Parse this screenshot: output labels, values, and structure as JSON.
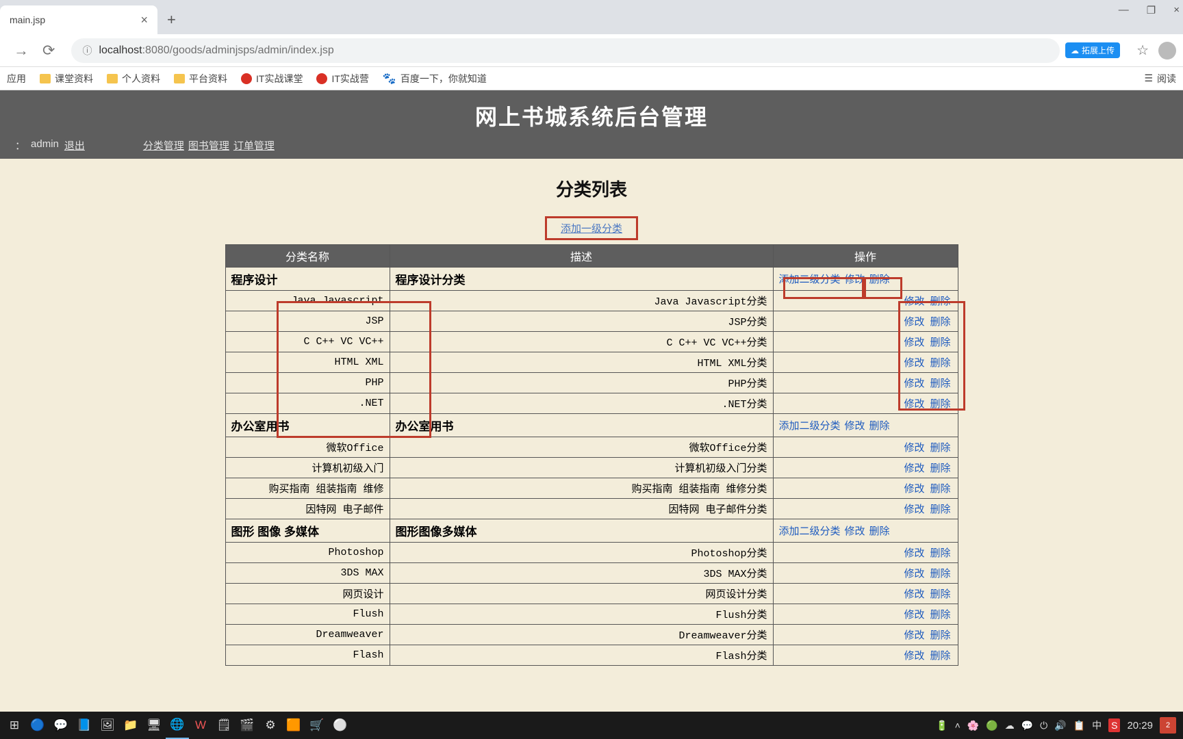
{
  "browser": {
    "tab_title": "main.jsp",
    "tab_close": "×",
    "new_tab": "+",
    "win_minimize": "—",
    "win_restore": "❐",
    "win_close": "×",
    "nav_forward": "→",
    "reload": "⟳",
    "url_icon": "ⓘ",
    "url_host": "localhost",
    "url_port_path": ":8080/goods/adminjsps/admin/index.jsp",
    "ext_label": "拓展上传",
    "star": "☆",
    "bm_apps": "应用",
    "bm1": "课堂资料",
    "bm2": "个人资料",
    "bm3": "平台资料",
    "bm4": "IT实战课堂",
    "bm5": "IT实战营",
    "bm6": "百度一下，你就知道",
    "bm_right": "阅读"
  },
  "page": {
    "app_title": "网上书城系统后台管理",
    "user_label_prefix": "：",
    "user_name": "admin",
    "logout": "退出",
    "menu": [
      "分类管理",
      "图书管理",
      "订单管理"
    ],
    "content_title": "分类列表",
    "add_top": "添加一级分类",
    "th_name": "分类名称",
    "th_desc": "描述",
    "th_ops": "操作",
    "parent_ops": [
      "添加二级分类",
      "修改",
      "删除"
    ],
    "child_ops": [
      "修改",
      "删除"
    ],
    "categories": [
      {
        "name": "程序设计",
        "desc": "程序设计分类",
        "children": [
          {
            "name": "Java Javascript",
            "desc": "Java Javascript分类"
          },
          {
            "name": "JSP",
            "desc": "JSP分类"
          },
          {
            "name": "C C++ VC VC++",
            "desc": "C C++ VC VC++分类"
          },
          {
            "name": "HTML XML",
            "desc": "HTML XML分类"
          },
          {
            "name": "PHP",
            "desc": "PHP分类"
          },
          {
            "name": ".NET",
            "desc": ".NET分类"
          }
        ]
      },
      {
        "name": "办公室用书",
        "desc": "办公室用书",
        "children": [
          {
            "name": "微软Office",
            "desc": "微软Office分类"
          },
          {
            "name": "计算机初级入门",
            "desc": "计算机初级入门分类"
          },
          {
            "name": "购买指南 组装指南 维修",
            "desc": "购买指南 组装指南 维修分类"
          },
          {
            "name": "因特网 电子邮件",
            "desc": "因特网 电子邮件分类"
          }
        ]
      },
      {
        "name": "图形 图像 多媒体",
        "desc": "图形图像多媒体",
        "children": [
          {
            "name": "Photoshop",
            "desc": "Photoshop分类"
          },
          {
            "name": "3DS MAX",
            "desc": "3DS MAX分类"
          },
          {
            "name": "网页设计",
            "desc": "网页设计分类"
          },
          {
            "name": "Flush",
            "desc": "Flush分类"
          },
          {
            "name": "Dreamweaver",
            "desc": "Dreamweaver分类"
          },
          {
            "name": "Flash",
            "desc": "Flash分类"
          }
        ]
      }
    ]
  },
  "taskbar": {
    "clock": "20:29",
    "notif": "2",
    "ime1": "中",
    "ime2": "S"
  }
}
